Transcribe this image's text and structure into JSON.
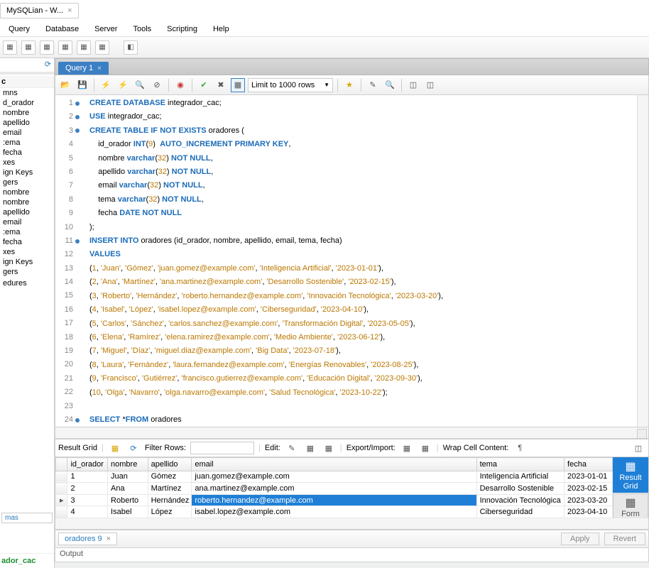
{
  "window": {
    "title": "MySQLian - W..."
  },
  "menus": [
    "Query",
    "Database",
    "Server",
    "Tools",
    "Scripting",
    "Help"
  ],
  "sidebar": {
    "group1": "c",
    "items1": [
      "mns",
      "d_orador",
      "nombre",
      "apellido",
      "email",
      ":ema",
      "fecha",
      "xes",
      "ign Keys",
      "gers",
      "nombre",
      "nombre",
      "apellido",
      "email",
      ":ema",
      "fecha",
      "xes",
      "ign Keys",
      "gers",
      "",
      "edures"
    ],
    "schemas_label": "mas",
    "bottom": "ador_cac"
  },
  "editor": {
    "tab": "Query 1",
    "limit": "Limit to 1000 rows"
  },
  "code_lines": [
    {
      "n": 1,
      "dot": true,
      "html": "<span class='kw'>CREATE DATABASE</span> integrador_cac;"
    },
    {
      "n": 2,
      "dot": true,
      "html": "<span class='kw'>USE</span> integrador_cac;"
    },
    {
      "n": 3,
      "dot": true,
      "html": "<span class='kw'>CREATE TABLE IF NOT EXISTS</span> oradores ("
    },
    {
      "n": 4,
      "dot": false,
      "html": "    id_orador <span class='ty'>INT</span>(<span class='num'>9</span>)  <span class='kw'>AUTO_INCREMENT PRIMARY KEY</span>,"
    },
    {
      "n": 5,
      "dot": false,
      "html": "    nombre <span class='ty'>varchar</span>(<span class='num'>32</span>) <span class='kw'>NOT NULL</span>,"
    },
    {
      "n": 6,
      "dot": false,
      "html": "    apellido <span class='ty'>varchar</span>(<span class='num'>32</span>) <span class='kw'>NOT NULL</span>,"
    },
    {
      "n": 7,
      "dot": false,
      "html": "    email <span class='ty'>varchar</span>(<span class='num'>32</span>) <span class='kw'>NOT NULL</span>,"
    },
    {
      "n": 8,
      "dot": false,
      "html": "    tema <span class='ty'>varchar</span>(<span class='num'>32</span>) <span class='kw'>NOT NULL</span>,"
    },
    {
      "n": 9,
      "dot": false,
      "html": "    fecha <span class='ty'>DATE</span> <span class='kw'>NOT NULL</span>"
    },
    {
      "n": 10,
      "dot": false,
      "html": ");"
    },
    {
      "n": 11,
      "dot": true,
      "html": "<span class='kw'>INSERT INTO</span> oradores (id_orador, nombre, apellido, email, tema, fecha)"
    },
    {
      "n": 12,
      "dot": false,
      "html": "<span class='kw'>VALUES</span>"
    },
    {
      "n": 13,
      "dot": false,
      "html": "(<span class='num'>1</span>, <span class='str'>'Juan'</span>, <span class='str'>'Gómez'</span>, <span class='str'>'juan.gomez@example.com'</span>, <span class='str'>'Inteligencia Artificial'</span>, <span class='str'>'2023-01-01'</span>),"
    },
    {
      "n": 14,
      "dot": false,
      "html": "(<span class='num'>2</span>, <span class='str'>'Ana'</span>, <span class='str'>'Martínez'</span>, <span class='str'>'ana.martinez@example.com'</span>, <span class='str'>'Desarrollo Sostenible'</span>, <span class='str'>'2023-02-15'</span>),"
    },
    {
      "n": 15,
      "dot": false,
      "html": "(<span class='num'>3</span>, <span class='str'>'Roberto'</span>, <span class='str'>'Hernández'</span>, <span class='str'>'roberto.hernandez@example.com'</span>, <span class='str'>'Innovación Tecnológica'</span>, <span class='str'>'2023-03-20'</span>),"
    },
    {
      "n": 16,
      "dot": false,
      "html": "(<span class='num'>4</span>, <span class='str'>'Isabel'</span>, <span class='str'>'López'</span>, <span class='str'>'isabel.lopez@example.com'</span>, <span class='str'>'Ciberseguridad'</span>, <span class='str'>'2023-04-10'</span>),"
    },
    {
      "n": 17,
      "dot": false,
      "html": "(<span class='num'>5</span>, <span class='str'>'Carlos'</span>, <span class='str'>'Sánchez'</span>, <span class='str'>'carlos.sanchez@example.com'</span>, <span class='str'>'Transformación Digital'</span>, <span class='str'>'2023-05-05'</span>),"
    },
    {
      "n": 18,
      "dot": false,
      "html": "(<span class='num'>6</span>, <span class='str'>'Elena'</span>, <span class='str'>'Ramírez'</span>, <span class='str'>'elena.ramirez@example.com'</span>, <span class='str'>'Medio Ambiente'</span>, <span class='str'>'2023-06-12'</span>),"
    },
    {
      "n": 19,
      "dot": false,
      "html": "(<span class='num'>7</span>, <span class='str'>'Miguel'</span>, <span class='str'>'Díaz'</span>, <span class='str'>'miguel.diaz@example.com'</span>, <span class='str'>'Big Data'</span>, <span class='str'>'2023-07-18'</span>),"
    },
    {
      "n": 20,
      "dot": false,
      "html": "(<span class='num'>8</span>, <span class='str'>'Laura'</span>, <span class='str'>'Fernández'</span>, <span class='str'>'laura.fernandez@example.com'</span>, <span class='str'>'Energías Renovables'</span>, <span class='str'>'2023-08-25'</span>),"
    },
    {
      "n": 21,
      "dot": false,
      "html": "(<span class='num'>9</span>, <span class='str'>'Francisco'</span>, <span class='str'>'Gutiérrez'</span>, <span class='str'>'francisco.gutierrez@example.com'</span>, <span class='str'>'Educación Digital'</span>, <span class='str'>'2023-09-30'</span>),"
    },
    {
      "n": 22,
      "dot": false,
      "html": "(<span class='num'>10</span>, <span class='str'>'Olga'</span>, <span class='str'>'Navarro'</span>, <span class='str'>'olga.navarro@example.com'</span>, <span class='str'>'Salud Tecnológica'</span>, <span class='str'>'2023-10-22'</span>);"
    },
    {
      "n": 23,
      "dot": false,
      "html": ""
    },
    {
      "n": 24,
      "dot": true,
      "html": "<span class='kw'>SELECT</span> *<span class='kw'>FROM</span> oradores"
    }
  ],
  "result": {
    "label_grid": "Result Grid",
    "filter_label": "Filter Rows:",
    "edit_label": "Edit:",
    "export_label": "Export/Import:",
    "wrap_label": "Wrap Cell Content:",
    "columns": [
      "",
      "id_orador",
      "nombre",
      "apellido",
      "email",
      "tema",
      "fecha"
    ],
    "rows": [
      {
        "ind": "",
        "id": "1",
        "nombre": "Juan",
        "apellido": "Gómez",
        "email": "juan.gomez@example.com",
        "tema": "Inteligencia Artificial",
        "fecha": "2023-01-01"
      },
      {
        "ind": "",
        "id": "2",
        "nombre": "Ana",
        "apellido": "Martínez",
        "email": "ana.martinez@example.com",
        "tema": "Desarrollo Sostenible",
        "fecha": "2023-02-15"
      },
      {
        "ind": "▸",
        "id": "3",
        "nombre": "Roberto",
        "apellido": "Hernández",
        "email": "roberto.hernandez@example.com",
        "tema": "Innovación Tecnológica",
        "fecha": "2023-03-20",
        "selected": true
      },
      {
        "ind": "",
        "id": "4",
        "nombre": "Isabel",
        "apellido": "López",
        "email": "isabel.lopez@example.com",
        "tema": "Ciberseguridad",
        "fecha": "2023-04-10"
      }
    ],
    "right_tools": [
      {
        "label": "Result\nGrid",
        "active": true
      },
      {
        "label": "Form\nEditor",
        "active": false
      }
    ]
  },
  "bottom": {
    "tab": "oradores 9",
    "apply": "Apply",
    "revert": "Revert"
  },
  "output_label": "Output"
}
